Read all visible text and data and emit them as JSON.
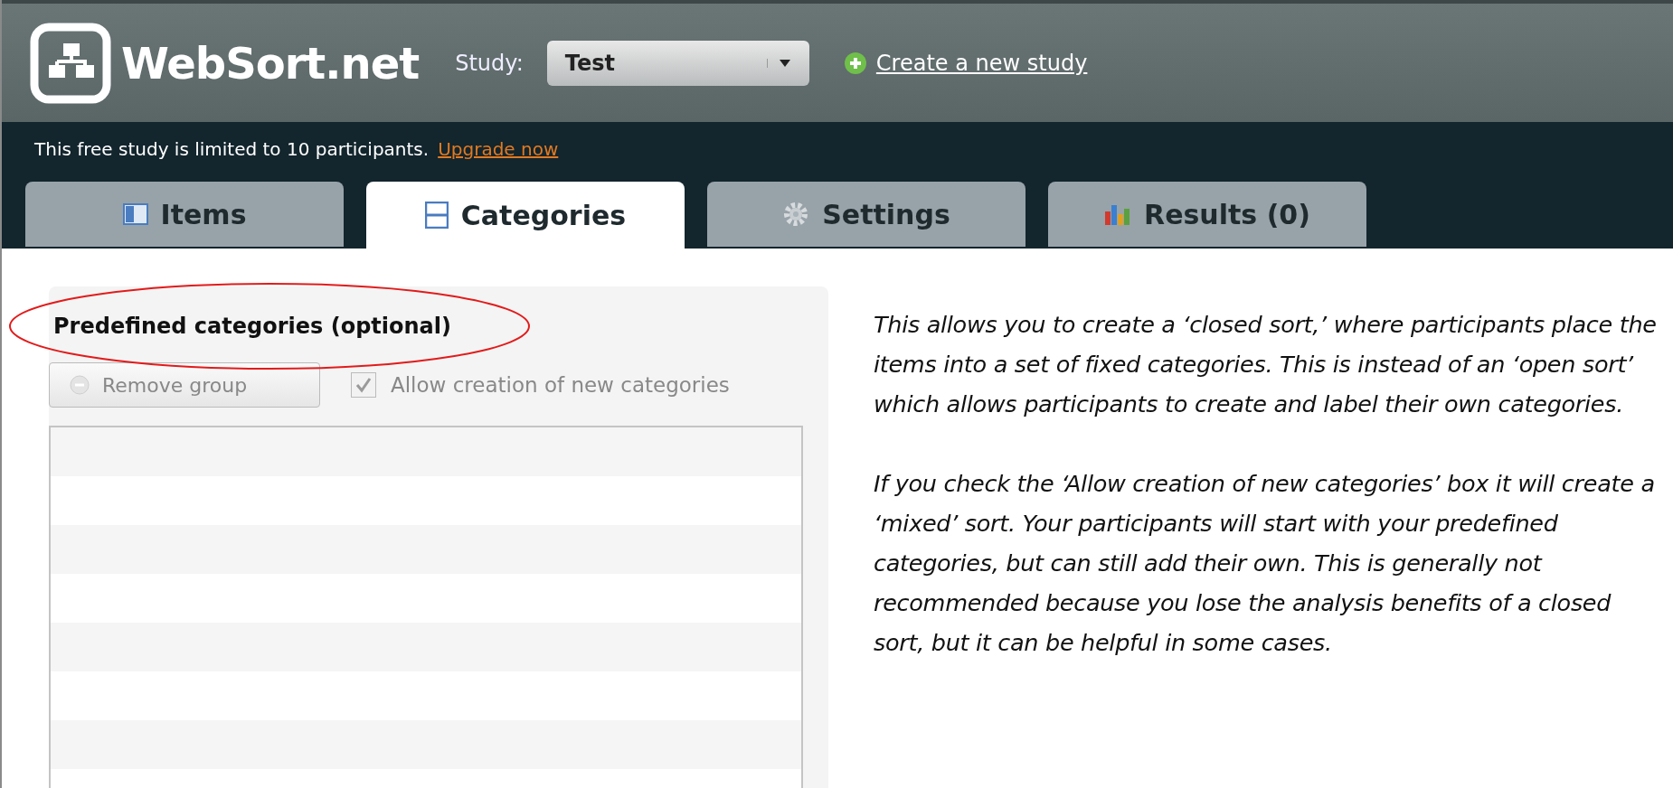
{
  "header": {
    "logo_text": "WebSort.net",
    "study_label": "Study:",
    "study_select": {
      "value": "Test"
    },
    "create_link": "Create a new study"
  },
  "notice": {
    "text": "This free study is limited to 10 participants.",
    "link": "Upgrade now"
  },
  "tabs": [
    {
      "label": "Items",
      "kind": "items",
      "selected": false
    },
    {
      "label": "Categories",
      "kind": "categories",
      "selected": true
    },
    {
      "label": "Settings",
      "kind": "settings",
      "selected": false
    },
    {
      "label": "Results (0)",
      "kind": "results",
      "selected": false
    }
  ],
  "panel": {
    "title": "Predefined categories (optional)",
    "title_annotated": true,
    "remove_button": {
      "label": "Remove group",
      "disabled": true
    },
    "allow_checkbox": {
      "label": "Allow creation of new categories",
      "checked": true,
      "disabled": true
    }
  },
  "help": [
    "This allows you to create a ‘closed sort,’ where participants place the items into a set of fixed categories. This is instead of an ‘open sort’ which allows participants to create and label their own categories.",
    "If you check the ‘Allow creation of new categories’ box it will create a ‘mixed’ sort. Your participants will start with your predefined categories, but can still add their own. This is generally not recommended because you lose the analysis benefits of a closed sort, but it can be helpful in some cases."
  ]
}
